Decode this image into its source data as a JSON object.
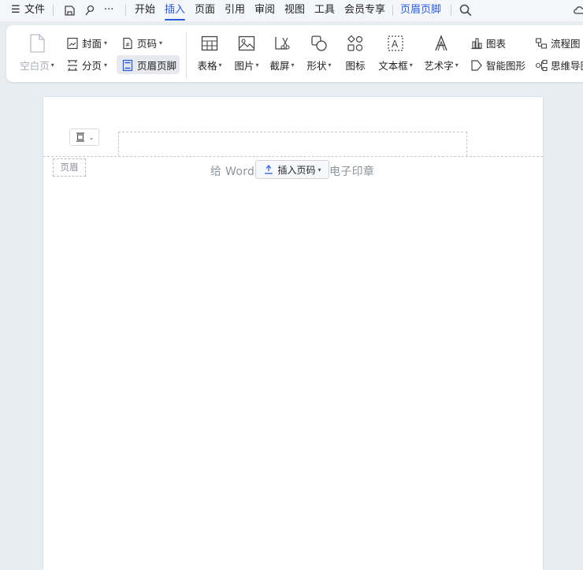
{
  "menubar": {
    "file": "文件",
    "more": "···",
    "tabs": [
      "开始",
      "插入",
      "页面",
      "引用",
      "审阅",
      "视图",
      "工具",
      "会员专享"
    ],
    "active_tab": "插入",
    "context_tab": "页眉页脚",
    "colors": {
      "accent": "#2a5bd7"
    }
  },
  "ribbon": {
    "blank_page": "空白页",
    "cover": "封面",
    "page_number": "页码",
    "page_break": "分页",
    "header_footer": "页眉页脚",
    "table": "表格",
    "picture": "图片",
    "screenshot": "截屏",
    "shape": "形状",
    "icon": "图标",
    "textbox": "文本框",
    "wordart": "艺术字",
    "chart": "图表",
    "smart_graphic": "智能图形",
    "flowchart": "流程图",
    "mindmap": "思维导图"
  },
  "document": {
    "header_tag": "页眉",
    "header_text_left": "给 Word",
    "header_text_right": "电子印章",
    "insert_page_number": "插入页码"
  }
}
